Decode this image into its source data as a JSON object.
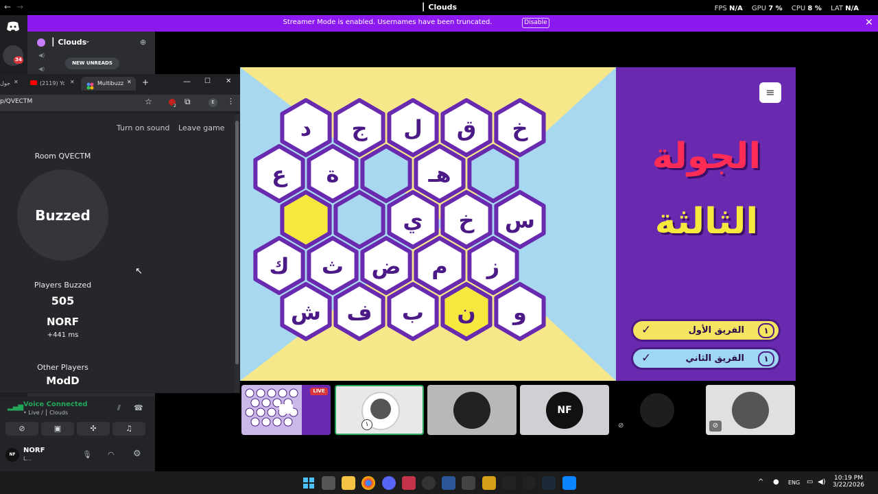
{
  "titlebar": {
    "back": "←",
    "forward": "→",
    "window_title": "⎮ Clouds",
    "fps_label": "FPS",
    "fps_value": "N/A",
    "gpu_label": "GPU",
    "gpu_value": "7 %",
    "cpu_label": "CPU",
    "cpu_value": "8 %",
    "lat_label": "LAT",
    "lat_value": "N/A"
  },
  "banner": {
    "message": "Streamer Mode is enabled. Usernames have been truncated.",
    "disable_label": "Disable",
    "close": "✕"
  },
  "rail": {
    "discord_icon": "discord-logo",
    "unread_badge": "34"
  },
  "server": {
    "name": "⎮ Clouds",
    "new_unreads": "NEW UNREADS"
  },
  "voice": {
    "status": "Voice Connected",
    "channel": "• Live / ⎮ Clouds",
    "user_name": "NORF",
    "user_status": "L...",
    "avatar_text": "NF"
  },
  "browser": {
    "tab1": "جول",
    "tab2": "(2119) Yo",
    "tab3": "Multibuzz",
    "new_tab": "+",
    "url": "p/QVECTM",
    "ext_badge": "2",
    "profile": "E"
  },
  "buzzer": {
    "turn_on_sound": "Turn on sound",
    "leave_game": "Leave game",
    "room": "Room QVECTM",
    "buzzed": "Buzzed",
    "players_buzzed_label": "Players Buzzed",
    "players_buzzed_count": "505",
    "first_player": "NORF",
    "first_player_time": "+441 ms",
    "other_players_label": "Other Players",
    "other_player": "ModD"
  },
  "game": {
    "hex_rows": [
      [
        "خ",
        "ق",
        "ل",
        "ج",
        "د"
      ],
      [
        "",
        "هـ",
        "",
        "ة",
        "ع"
      ],
      [
        "س",
        "خ",
        "ي",
        "",
        ""
      ],
      [
        "ز",
        "م",
        "ض",
        "ث",
        "ك"
      ],
      [
        "و",
        "ن",
        "ب",
        "ف",
        "ش"
      ]
    ],
    "hex_states": [
      [
        "white",
        "white",
        "white",
        "white",
        "white"
      ],
      [
        "blue",
        "white",
        "blue",
        "white",
        "white"
      ],
      [
        "white",
        "white",
        "white",
        "blue",
        "yellow"
      ],
      [
        "white",
        "white",
        "white",
        "white",
        "white"
      ],
      [
        "white",
        "yellow",
        "white",
        "white",
        "white"
      ]
    ],
    "round_line1": "الجولة",
    "round_line2": "الثالثة",
    "menu_icon": "hamburger-icon",
    "team1_name": "الفريق الأول",
    "team1_score": "١",
    "team2_name": "الفريق الثاني",
    "team2_score": "١",
    "check": "✓"
  },
  "participants": {
    "live_badge": "LIVE",
    "nf_tile_text": "NF",
    "tile_badge_1": "١"
  },
  "taskbar": {
    "time": "10:19 PM",
    "date": "3/22/2026",
    "lang": "ENG"
  },
  "colors": {
    "banner": "#8c1af0",
    "game_purple": "#6a2ab0",
    "hex_yellow": "#f6e83c",
    "hex_blue": "#a8d8f0",
    "team1": "#f5e460",
    "team2": "#9fd6f2"
  }
}
